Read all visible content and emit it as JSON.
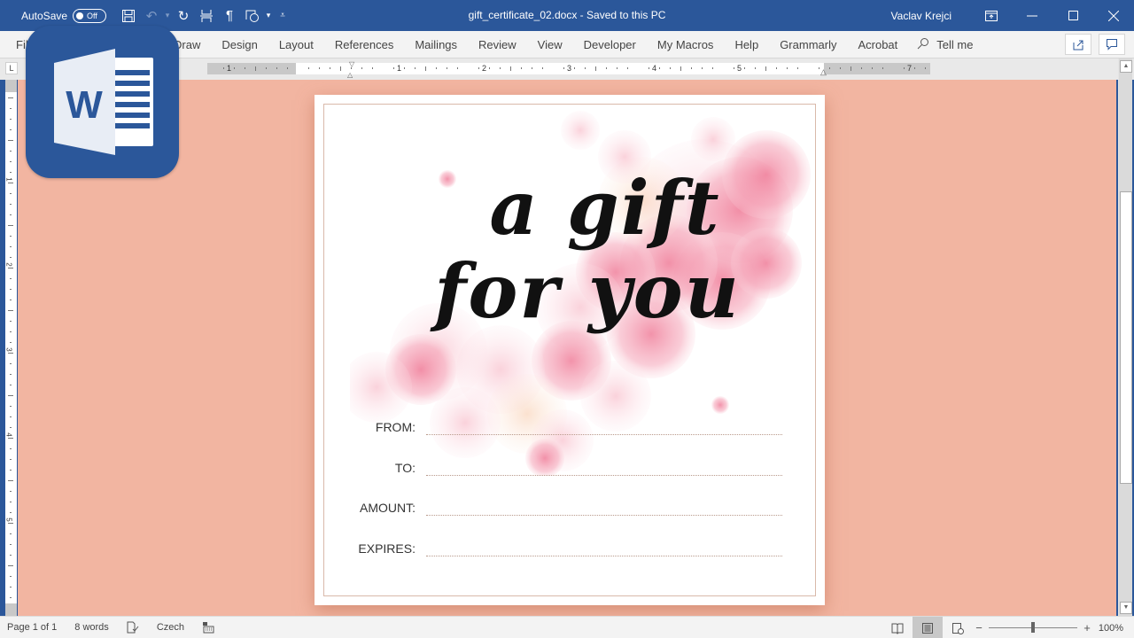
{
  "titlebar": {
    "autosave_label": "AutoSave",
    "autosave_state": "Off",
    "doc_title": "gift_certificate_02.docx  -  Saved to this PC",
    "user_name": "Vaclav Krejci"
  },
  "ribbon": {
    "tabs": [
      "File",
      "Draw",
      "Design",
      "Layout",
      "References",
      "Mailings",
      "Review",
      "View",
      "Developer",
      "My Macros",
      "Help",
      "Grammarly",
      "Acrobat"
    ],
    "file_visible_label": "Fil",
    "tell_me": "Tell me"
  },
  "ruler": {
    "h_numbers": [
      "1",
      "1",
      "2",
      "3",
      "4",
      "5",
      "7"
    ],
    "v_numbers": [
      "1",
      "2",
      "3",
      "4",
      "5"
    ]
  },
  "document": {
    "headline_line1": "a gift",
    "headline_line2": "for you",
    "fields": [
      {
        "label": "FROM:",
        "value": ""
      },
      {
        "label": "TO:",
        "value": ""
      },
      {
        "label": "AMOUNT:",
        "value": ""
      },
      {
        "label": "EXPIRES:",
        "value": ""
      }
    ]
  },
  "statusbar": {
    "page": "Page 1 of 1",
    "words": "8 words",
    "language": "Czech",
    "zoom": "100%",
    "zoom_fraction": 0.5
  },
  "colors": {
    "word_blue": "#2b579a",
    "canvas_bg": "#f2b5a1",
    "flower_pink": "#f08aa4"
  }
}
